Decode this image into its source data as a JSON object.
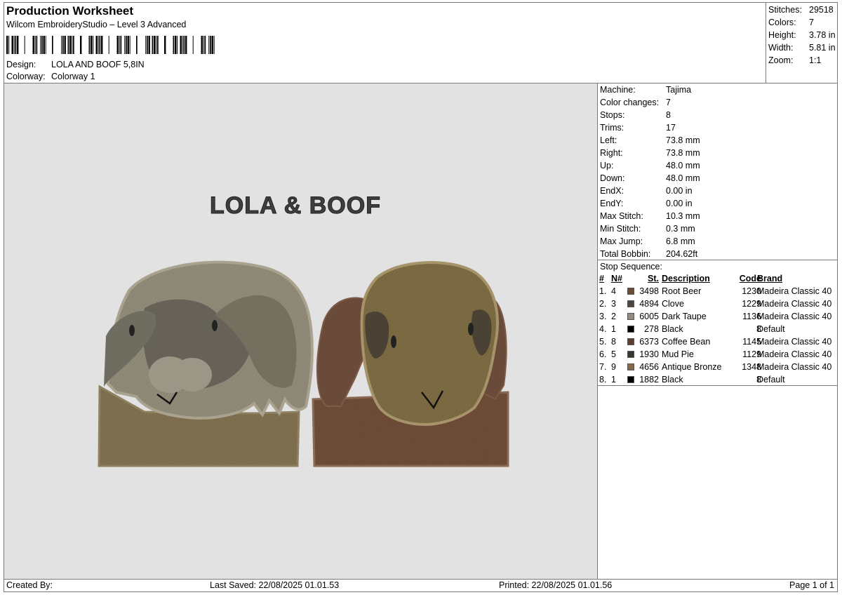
{
  "header": {
    "title": "Production Worksheet",
    "software": "Wilcom EmbroideryStudio – Level 3 Advanced",
    "design_label": "Design:",
    "design_value": "LOLA AND BOOF 5,8IN",
    "colorway_label": "Colorway:",
    "colorway_value": "Colorway 1"
  },
  "summary": {
    "stitches_label": "Stitches:",
    "stitches": "29518",
    "colors_label": "Colors:",
    "colors": "7",
    "height_label": "Height:",
    "height": "3.78 in",
    "width_label": "Width:",
    "width": "5.81 in",
    "zoom_label": "Zoom:",
    "zoom": "1:1"
  },
  "design_preview": {
    "text": "LOLA & BOOF"
  },
  "machine_info": [
    {
      "label": "Machine:",
      "value": "Tajima"
    },
    {
      "label": "Color changes:",
      "value": "7"
    },
    {
      "label": "Stops:",
      "value": "8"
    },
    {
      "label": "Trims:",
      "value": "17"
    },
    {
      "label": "Left:",
      "value": "73.8 mm"
    },
    {
      "label": "Right:",
      "value": "73.8 mm"
    },
    {
      "label": "Up:",
      "value": "48.0 mm"
    },
    {
      "label": "Down:",
      "value": "48.0 mm"
    },
    {
      "label": "EndX:",
      "value": "0.00 in"
    },
    {
      "label": "EndY:",
      "value": "0.00 in"
    },
    {
      "label": "Max Stitch:",
      "value": "10.3 mm"
    },
    {
      "label": "Min Stitch:",
      "value": "0.3 mm"
    },
    {
      "label": "Max Jump:",
      "value": "6.8 mm"
    },
    {
      "label": "Total Bobbin:",
      "value": "204.62ft"
    }
  ],
  "stop_sequence": {
    "title": "Stop Sequence:",
    "headers": {
      "idx": "#",
      "n": "N#",
      "st": "St.",
      "desc": "Description",
      "code": "Code",
      "brand": "Brand"
    },
    "rows": [
      {
        "idx": "1.",
        "n": "4",
        "color": "#6b4a35",
        "st": "3498",
        "desc": "Root Beer",
        "code": "1230",
        "brand": "Madeira Classic 40"
      },
      {
        "idx": "2.",
        "n": "3",
        "color": "#4d4640",
        "st": "4894",
        "desc": "Clove",
        "code": "1229",
        "brand": "Madeira Classic 40"
      },
      {
        "idx": "3.",
        "n": "2",
        "color": "#948a7e",
        "st": "6005",
        "desc": "Dark Taupe",
        "code": "1136",
        "brand": "Madeira Classic 40"
      },
      {
        "idx": "4.",
        "n": "1",
        "color": "#000000",
        "st": "278",
        "desc": "Black",
        "code": "8",
        "brand": "Default"
      },
      {
        "idx": "5.",
        "n": "8",
        "color": "#5e3e2c",
        "st": "6373",
        "desc": "Coffee Bean",
        "code": "1145",
        "brand": "Madeira Classic 40"
      },
      {
        "idx": "6.",
        "n": "5",
        "color": "#3b362e",
        "st": "1930",
        "desc": "Mud Pie",
        "code": "1129",
        "brand": "Madeira Classic 40"
      },
      {
        "idx": "7.",
        "n": "9",
        "color": "#85694a",
        "st": "4656",
        "desc": "Antique Bronze",
        "code": "1348",
        "brand": "Madeira Classic 40"
      },
      {
        "idx": "8.",
        "n": "1",
        "color": "#000000",
        "st": "1882",
        "desc": "Black",
        "code": "8",
        "brand": "Default"
      }
    ]
  },
  "footer": {
    "created_by": "Created By:",
    "last_saved": "Last Saved: 22/08/2025 01.01.53",
    "printed": "Printed: 22/08/2025 01.01.56",
    "page": "Page 1 of 1"
  }
}
